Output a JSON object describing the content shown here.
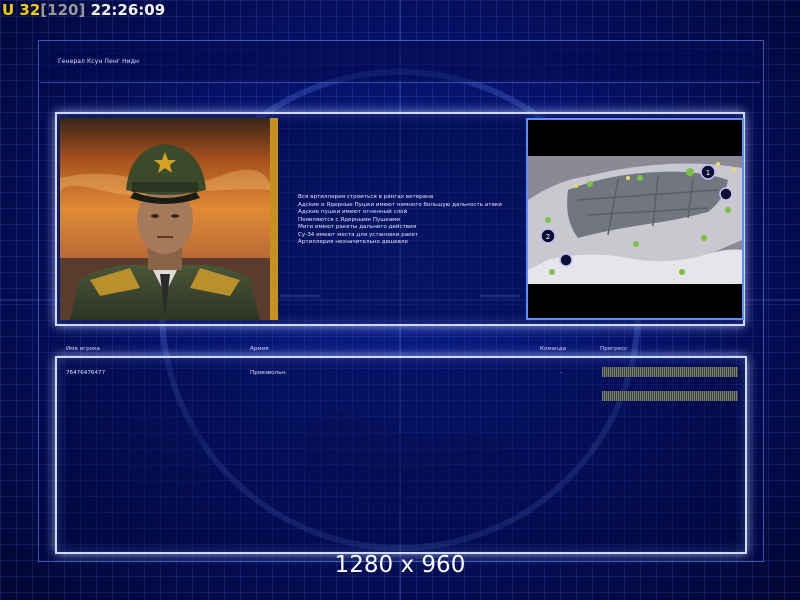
{
  "hud": {
    "units_prefix": "U",
    "units_count": "32",
    "units_max": "[120]",
    "clock": "22:26:09"
  },
  "briefing": {
    "general_name": "Генерал Ксун Пенг Нидн",
    "lines": [
      "Вся артиллерия строиться в рангах ветерана",
      "Адские и Ядерные Пушки имеют немного большую дальность атаки",
      "Адские пушки имеют огненный слой",
      "Появляются с Ядерными Пушками",
      "Миги имеют ракеты дальнего действия",
      "Су-34 имеют места для установки ракет",
      "Артиллерия незначительно дешевле"
    ]
  },
  "minimap": {
    "start_positions": [
      "1",
      "2"
    ]
  },
  "player_list": {
    "columns": {
      "name": "Имя игрока",
      "army": "Армия",
      "team": "Команда",
      "progress": "Прогресс"
    },
    "rows": [
      {
        "name": "76476476477",
        "army": "Произвольн.",
        "team": "-",
        "progress": 1.0
      }
    ],
    "extra_progress": 1.0
  },
  "footer": {
    "resolution": "1280 x 960"
  },
  "colors": {
    "hud_units": "#f0d000",
    "hud_bracket": "#9a9a9a",
    "panel_border": "#cfd8ff",
    "minimap_border": "#5f8fff",
    "portrait_frame": "#c8901c"
  }
}
